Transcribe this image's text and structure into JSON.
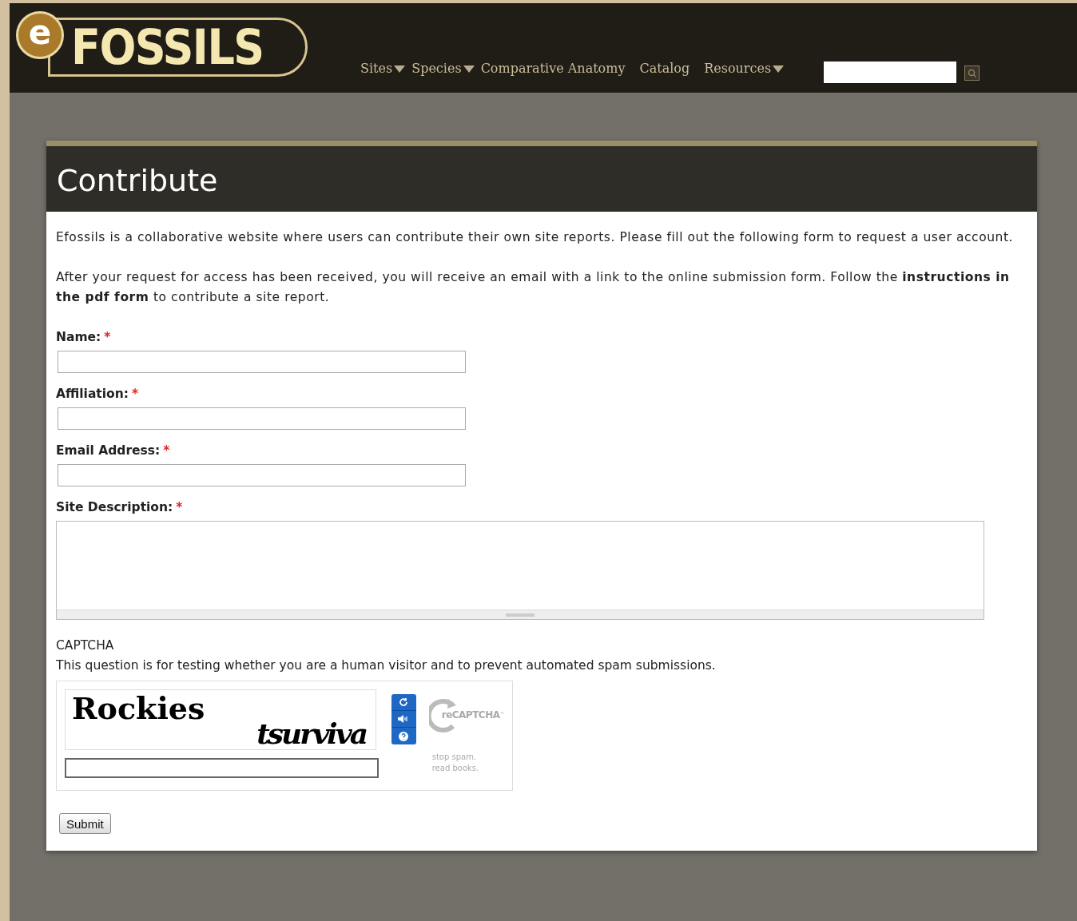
{
  "logo": {
    "badge": "e",
    "name": "FOSSILS"
  },
  "nav": [
    {
      "label": "Sites",
      "dropdown": true
    },
    {
      "label": "Species",
      "dropdown": true
    },
    {
      "label": "Comparative Anatomy",
      "dropdown": false
    },
    {
      "label": "Catalog",
      "dropdown": false
    },
    {
      "label": "Resources",
      "dropdown": true
    }
  ],
  "page": {
    "title": "Contribute",
    "paragraphs": [
      "Efossils is a collaborative website where users can contribute their own site reports.  Please fill out the following form to request a user account.",
      "After your request for access has been received, you will receive an email with a link to the online submission form.  Follow the **instructions in the pdf form** to contribute a site report."
    ],
    "fields": [
      {
        "label": "Name:",
        "required_mark": "*",
        "kind": "text"
      },
      {
        "label": "Affiliation:",
        "required_mark": "*",
        "kind": "text"
      },
      {
        "label": "Email Address:",
        "required_mark": "*",
        "kind": "text"
      },
      {
        "label": "Site Description:",
        "required_mark": "*",
        "kind": "textarea"
      }
    ],
    "captcha": {
      "heading": "CAPTCHA",
      "description": "This question is for testing whether you are a human visitor and to prevent automated spam submissions.",
      "word_1": "Rockies",
      "word_2": "tsurviva",
      "brand": "reCAPTCHA",
      "brand_mark": "™",
      "slogan": "stop spam.\nread books."
    },
    "submit": "Submit"
  }
}
